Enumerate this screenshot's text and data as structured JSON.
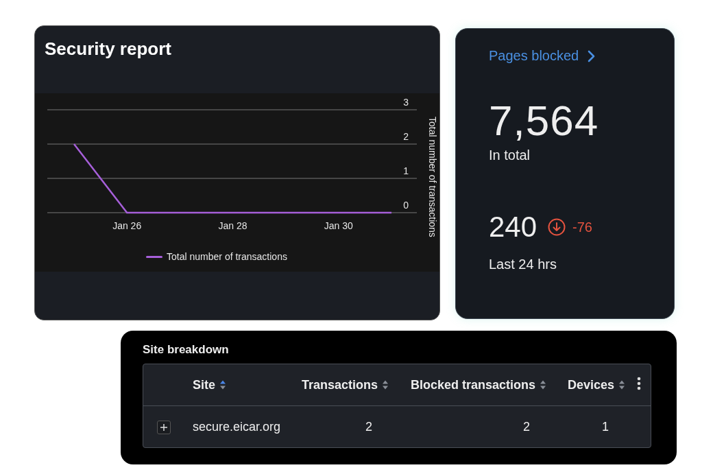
{
  "security_report": {
    "title": "Security report",
    "chart_data": {
      "type": "line",
      "ylabel": "Total number of transactions",
      "categories": [
        null,
        "Jan 26",
        null,
        "Jan 28",
        null,
        "Jan 30",
        null
      ],
      "ylim": [
        0,
        3
      ],
      "yticks": [
        0,
        1,
        2,
        3
      ],
      "series": [
        {
          "name": "Total number of transactions",
          "color": "#a65fd9",
          "values": [
            2,
            0,
            0,
            0,
            0,
            0,
            0
          ]
        }
      ]
    }
  },
  "pages_blocked": {
    "title": "Pages blocked",
    "total": "7,564",
    "total_label": "In total",
    "recent": "240",
    "change": "-76",
    "decreased": true,
    "recent_label": "Last 24 hrs"
  },
  "site_breakdown": {
    "title": "Site breakdown",
    "columns": [
      {
        "label": "Site",
        "sorted": true
      },
      {
        "label": "Transactions",
        "sorted": false
      },
      {
        "label": "Blocked transactions",
        "sorted": false
      },
      {
        "label": "Devices",
        "sorted": false
      }
    ],
    "rows": [
      {
        "expanded": false,
        "cells": [
          "secure.eicar.org",
          "2",
          "2",
          "1"
        ]
      }
    ]
  }
}
